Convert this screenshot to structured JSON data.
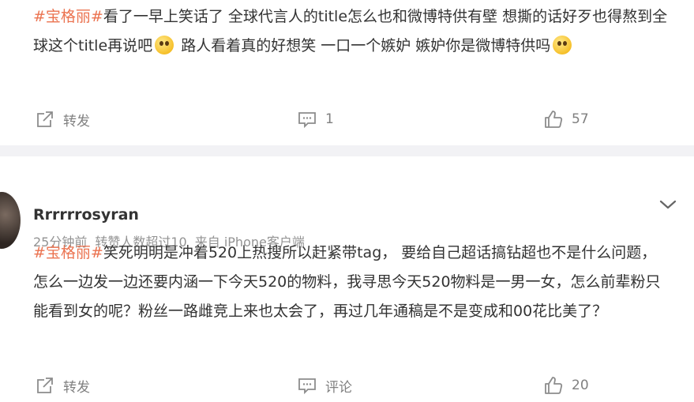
{
  "post1": {
    "tag": "#宝格丽#",
    "text_part1": "看了一早上笑话了 全球代言人的title怎么也和微博特供有壁 想撕的话好歹也得熬到全球这个title再说吧",
    "text_part2": " 路人看着真的好想笑 一口一个嫉妒 嫉妒你是微博特供吗",
    "emoji1": "eye-roll-emoji-icon",
    "emoji2": "laughing-tears-emoji-icon",
    "actions": {
      "repost_label": "转发",
      "comment_count": "1",
      "like_count": "57"
    }
  },
  "post2": {
    "username": "Rrrrrrosyran",
    "time": "25分钟前",
    "repost_info": "转赞人数超过10",
    "source": "来自 iPhone客户端",
    "tag": "#宝格丽#",
    "text": "笑死明明是冲着520上热搜所以赶紧带tag， 要给自己超话搞钻超也不是什么问题，怎么一边发一边还要内涵一下今天520的物料，我寻思今天520物料是一男一女，怎么前辈粉只能看到女的呢？粉丝一路雌竞上来也太会了，再过几年通稿是不是变成和00花比美了？",
    "actions": {
      "repost_label": "转发",
      "comment_label": "评论",
      "like_count": "20"
    }
  },
  "colors": {
    "tag": "#eb7350",
    "text": "#333333",
    "meta": "#939393",
    "action": "#808080",
    "divider": "#f2f2f5"
  }
}
